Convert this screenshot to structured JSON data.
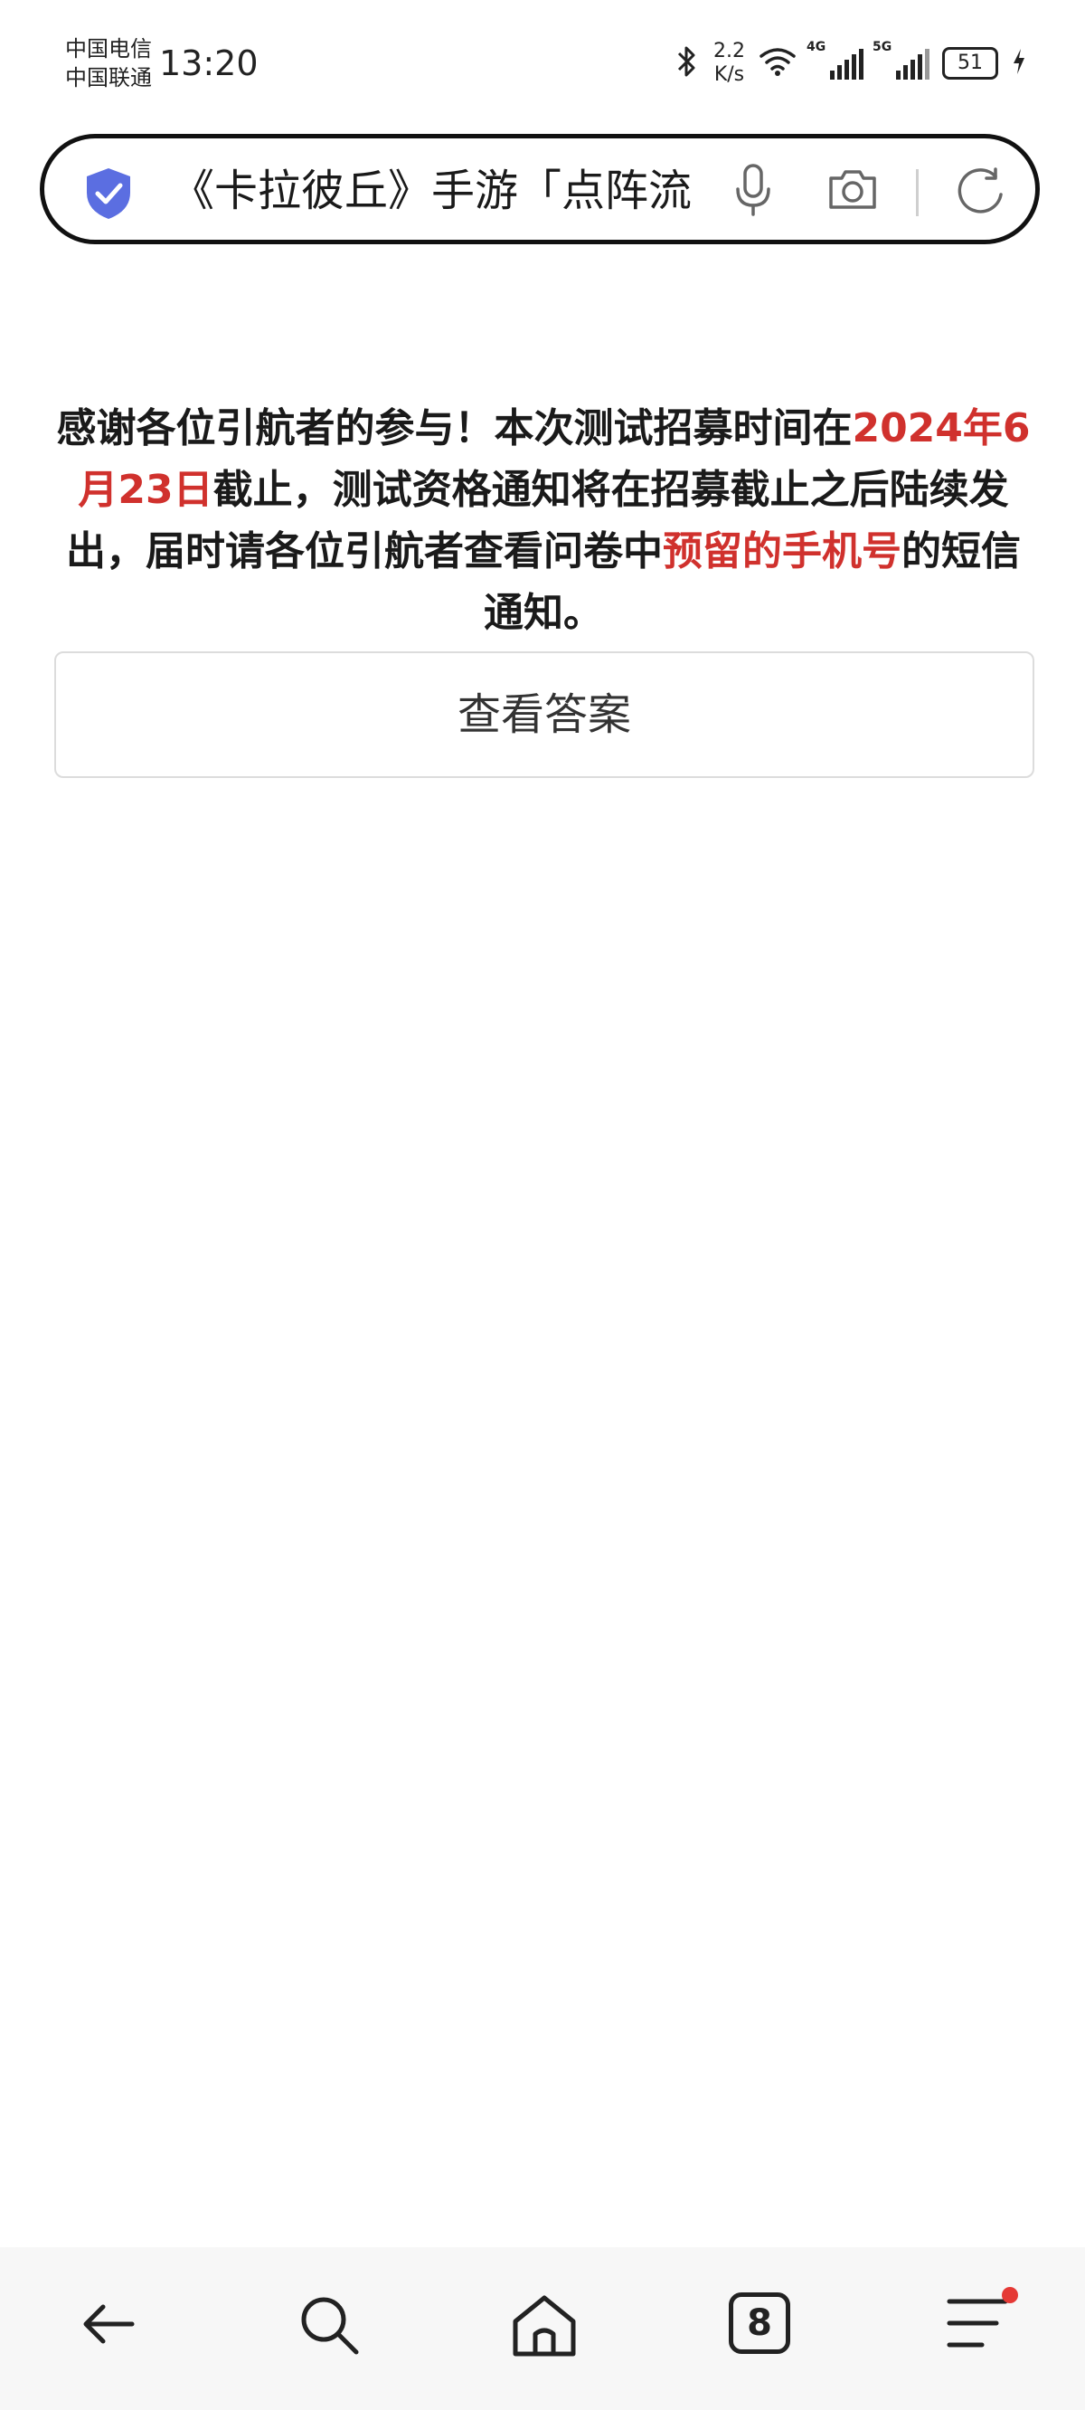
{
  "status_bar": {
    "carrier_1": "中国电信",
    "carrier_2": "中国联通",
    "time": "13:20",
    "net_speed_value": "2.2",
    "net_speed_unit": "K/s",
    "signal_1_label": "4G",
    "signal_2_label": "5G",
    "battery_level": "51"
  },
  "address_bar": {
    "url_text": "《卡拉彼丘》手游「点阵流"
  },
  "content": {
    "notice_part_1": "感谢各位引航者的参与！本次测试招募时间在",
    "notice_date": "2024年6月23日",
    "notice_part_2": "截止，测试资格通知将在招募截止之后陆续发出，届时请各位引航者查看问卷中",
    "notice_phone": "预留的手机号",
    "notice_part_3": "的短信通知。",
    "view_answers_button": "查看答案"
  },
  "bottom_nav": {
    "tab_count": "8"
  },
  "colors": {
    "accent_red": "#d0312d",
    "shield_blue": "#5b6ee1",
    "badge_red": "#e53935"
  }
}
